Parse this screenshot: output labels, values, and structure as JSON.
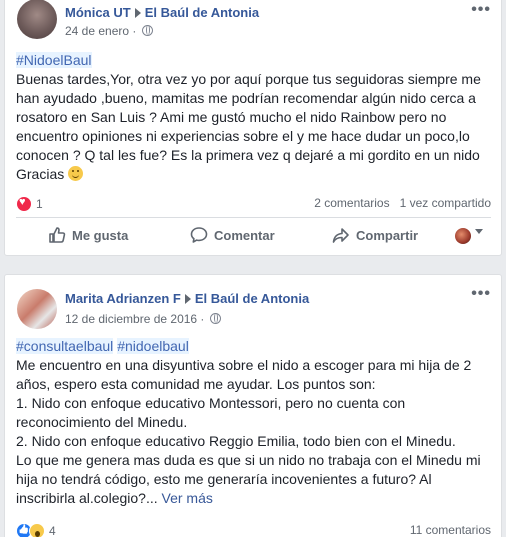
{
  "posts": [
    {
      "author": "Mónica UT",
      "group": "El Baúl de Antonia",
      "date": "24 de enero",
      "more": "•••",
      "hashtags": [
        "#NidoelBaul"
      ],
      "body": "Buenas tardes,Yor, otra vez yo por aquí porque tus seguidoras siempre me han ayudado ,bueno, mamitas me podrían recomendar algún nido cerca a rosatoro en San Luis ? Ami me gustó mucho el nido Rainbow pero no encuentro opiniones ni experiencias sobre el y me hace dudar un poco,lo conocen ? Q tal les fue? Es la primera vez q dejaré a mi gordito en un nido Gracias",
      "reactions": {
        "icons": [
          "love-icon"
        ],
        "count": "1"
      },
      "comments": "2 comentarios",
      "shares": "1 vez compartido",
      "actions": {
        "like": "Me gusta",
        "comment": "Comentar",
        "share": "Compartir"
      }
    },
    {
      "author": "Marita Adrianzen F",
      "group": "El Baúl de Antonia",
      "date": "12 de diciembre de 2016",
      "more": "•••",
      "hashtags": [
        "#consultaelbaul",
        "#nidoelbaul"
      ],
      "body_lines": [
        "Me encuentro en una disyuntiva sobre el nido a escoger para mi hija de 2 años, espero esta comunidad me ayudar. Los puntos son:",
        "1. Nido con enfoque educativo Montessori, pero no cuenta con reconocimiento del Minedu.",
        "2. Nido con enfoque educativo Reggio Emilia, todo bien con el Minedu.",
        "Lo que me genera mas duda es que si un nido no trabaja con el Minedu mi hija no tendrá código, esto me generaría incovenientes a futuro? Al inscribirla al.colegio?..."
      ],
      "see_more": "Ver más",
      "reactions": {
        "icons": [
          "like-icon",
          "wow-icon"
        ],
        "count": "4"
      },
      "comments": "11 comentarios"
    }
  ],
  "colors": {
    "link": "#365899",
    "hashtag_bg": "#e7f3ff",
    "love": "#f0284a",
    "like": "#2078f4",
    "wow": "#f7c94b"
  }
}
